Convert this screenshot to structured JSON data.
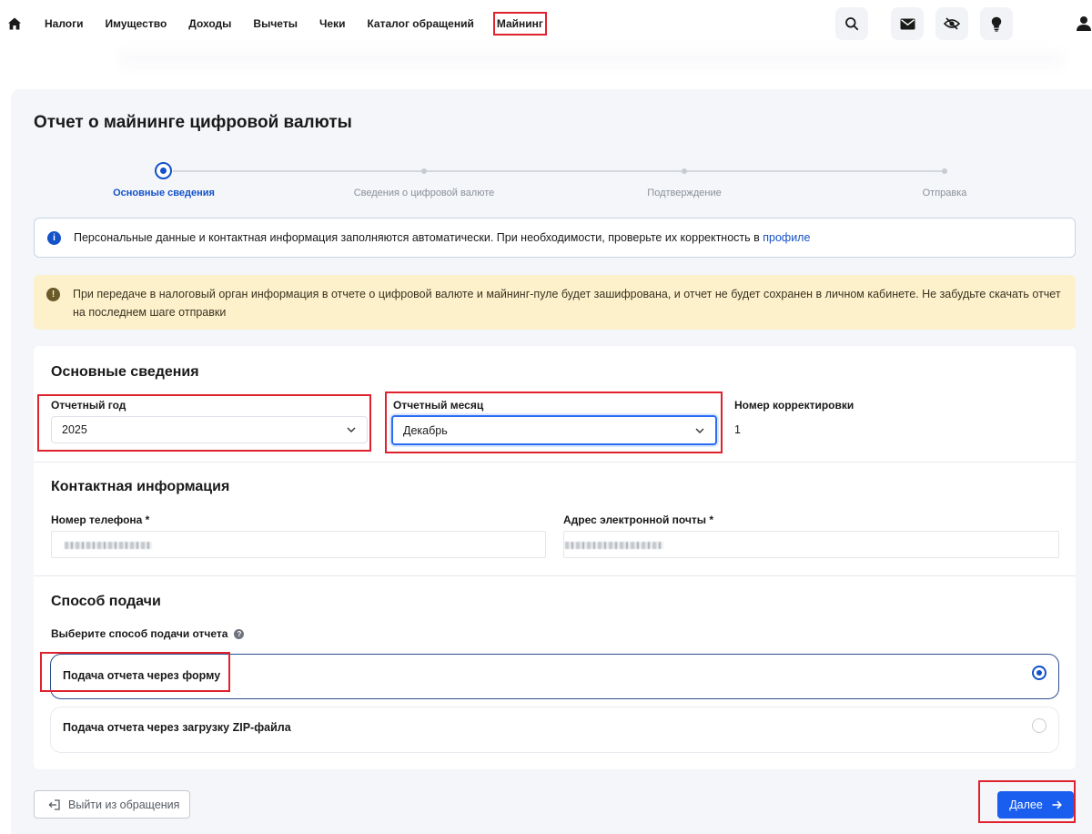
{
  "nav": {
    "items": [
      "Налоги",
      "Имущество",
      "Доходы",
      "Вычеты",
      "Чеки",
      "Каталог обращений"
    ],
    "active": "Майнинг"
  },
  "page": {
    "title": "Отчет о майнинге цифровой валюты"
  },
  "stepper": {
    "steps": [
      "Основные сведения",
      "Сведения о цифровой валюте",
      "Подтверждение",
      "Отправка"
    ],
    "active_index": 0
  },
  "alerts": {
    "info_text": "Персональные данные и контактная информация заполняются автоматически. При необходимости, проверьте их корректность в ",
    "info_link": "профиле",
    "warn_line1": "При передаче в налоговый орган информация в отчете о цифровой валюте и майнинг-пуле будет зашифрована, и отчет не будет сохранен в личном кабинете. Не забудьте скачать отчет",
    "warn_line2": "на последнем шаге отправки"
  },
  "basic": {
    "title": "Основные сведения",
    "year_label": "Отчетный год",
    "year_value": "2025",
    "month_label": "Отчетный месяц",
    "month_value": "Декабрь",
    "correction_label": "Номер корректировки",
    "correction_value": "1"
  },
  "contact": {
    "title": "Контактная информация",
    "phone_label": "Номер телефона *",
    "email_label": "Адрес электронной почты *"
  },
  "submission": {
    "title": "Способ подачи",
    "question": "Выберите способ подачи отчета",
    "options": [
      "Подача отчета через форму",
      "Подача отчета через загрузку ZIP-файла"
    ],
    "selected_index": 0
  },
  "buttons": {
    "exit": "Выйти из обращения",
    "next": "Далее"
  },
  "colors": {
    "accent": "#1352c9",
    "primary_button": "#1a5ef0",
    "highlight": "#e0222e",
    "warning_bg": "#fdf1cc"
  }
}
